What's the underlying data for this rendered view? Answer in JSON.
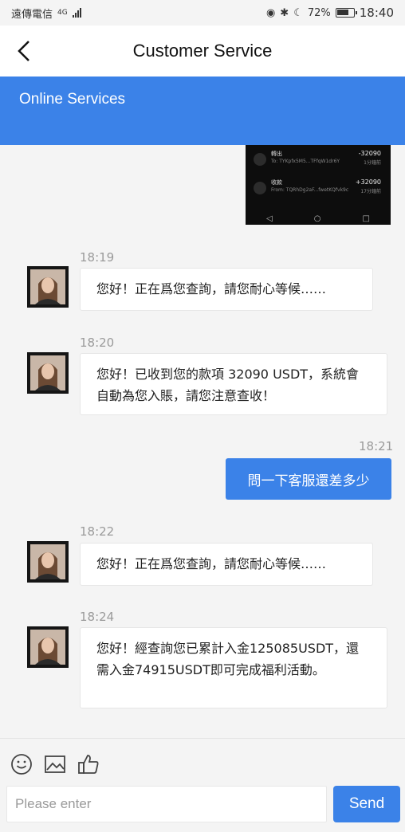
{
  "status_bar": {
    "carrier": "遠傳電信",
    "network": "4G",
    "battery": "72%",
    "time": "18:40"
  },
  "header": {
    "title": "Customer Service"
  },
  "banner": {
    "title": "Online Services"
  },
  "screenshot_message": {
    "rows": [
      {
        "title": "轉出",
        "sub": "To: TYKpfx5M5...TFfqW1dr6Y",
        "amount": "-32090",
        "when": "1分鐘前"
      },
      {
        "title": "收款",
        "sub": "From: TQRhDg2aF...fwetKQfvk9c",
        "amount": "+32090",
        "when": "17分鐘前"
      }
    ],
    "nav": [
      "◁",
      "○",
      "□"
    ]
  },
  "messages": [
    {
      "time": "18:19",
      "text": "您好！正在爲您查詢，請您耐心等候……"
    },
    {
      "time": "18:20",
      "text": "您好！已收到您的款項 32090 USDT，系統會自動為您入賬，請您注意查收！"
    },
    {
      "time": "18:21",
      "text": "問一下客服還差多少"
    },
    {
      "time": "18:22",
      "text": "您好！正在爲您查詢，請您耐心等候……"
    },
    {
      "time": "18:24",
      "text": "您好！經查詢您已累計入金125085USDT，還需入金74915USDT即可完成福利活動。"
    }
  ],
  "toolbar": {
    "icons": [
      "emoji-icon",
      "image-icon",
      "thumbs-up-icon"
    ],
    "input_placeholder": "Please enter",
    "send_label": "Send"
  },
  "colors": {
    "accent": "#3b82e8",
    "background": "#f4f4f4",
    "bubble": "#ffffff"
  }
}
